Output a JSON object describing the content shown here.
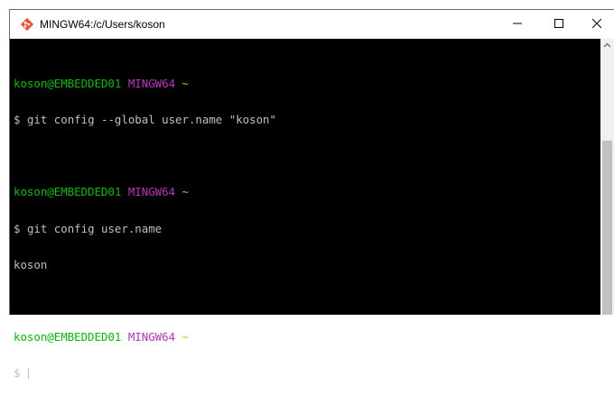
{
  "window": {
    "title": "MINGW64:/c/Users/koson",
    "app_icon": "git-bash-icon",
    "controls": {
      "minimize_icon": "minimize-icon",
      "maximize_icon": "maximize-icon",
      "close_icon": "close-icon"
    }
  },
  "terminal": {
    "prompt": {
      "user_host": "koson@EMBEDDED01",
      "shell": "MINGW64",
      "cwd": "~",
      "symbol": "$"
    },
    "blocks": [
      {
        "command": "git config --global user.name \"koson\"",
        "output": ""
      },
      {
        "command": "git config user.name",
        "output": "koson"
      }
    ],
    "colors": {
      "background": "#000000",
      "text": "#bfbfbf",
      "user_host": "#00c000",
      "shell": "#c030c0",
      "cwd": "#c0c000"
    }
  },
  "scrollbar": {
    "up_arrow_icon": "scroll-up-arrow-icon"
  }
}
